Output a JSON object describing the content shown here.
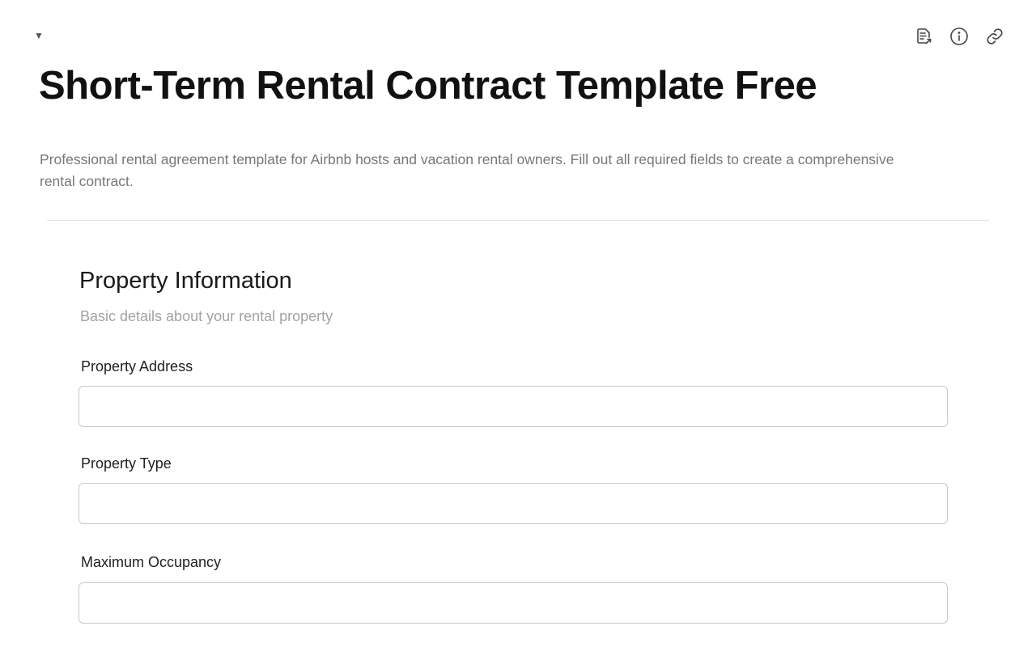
{
  "header": {
    "collapse_glyph": "▼",
    "title": "Short-Term Rental Contract Template Free",
    "description": "Professional rental agreement template for Airbnb hosts and vacation rental owners. Fill out all required fields to create a comprehensive rental contract."
  },
  "toolbar": {
    "icons": [
      "document-export-icon",
      "info-icon",
      "link-icon"
    ]
  },
  "section": {
    "title": "Property Information",
    "subtitle": "Basic details about your rental property",
    "fields": [
      {
        "label": "Property Address",
        "value": "",
        "placeholder": ""
      },
      {
        "label": "Property Type",
        "value": "",
        "placeholder": ""
      },
      {
        "label": "Maximum Occupancy",
        "value": "",
        "placeholder": ""
      }
    ]
  }
}
